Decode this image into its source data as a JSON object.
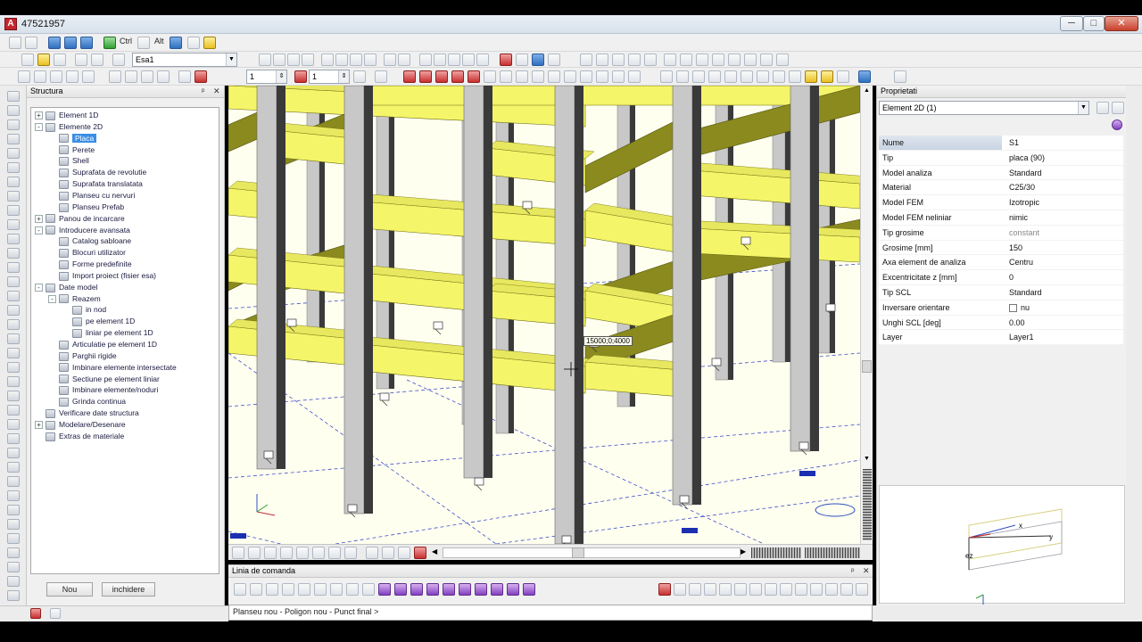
{
  "window": {
    "title": "47521957",
    "minimize": "─",
    "maximize": "□",
    "close": "✕"
  },
  "toolbar1": {
    "ctrl_label": "Ctrl",
    "alt_label": "Alt"
  },
  "toolbar2": {
    "project_combo": "Esa1"
  },
  "toolbar3": {
    "spinner1_value": "1",
    "spinner2_value": "1"
  },
  "structura": {
    "title": "Structura",
    "pin": "ᵖ",
    "close": "✕",
    "tree": [
      {
        "label": "Element 1D",
        "level": 0,
        "expander": "+"
      },
      {
        "label": "Elemente 2D",
        "level": 0,
        "expander": "-"
      },
      {
        "label": "Placa",
        "level": 1,
        "selected": true
      },
      {
        "label": "Perete",
        "level": 1
      },
      {
        "label": "Shell",
        "level": 1
      },
      {
        "label": "Suprafata de revolutie",
        "level": 1
      },
      {
        "label": "Suprafata translatata",
        "level": 1
      },
      {
        "label": "Planseu cu nervuri",
        "level": 1
      },
      {
        "label": "Planseu Prefab",
        "level": 1
      },
      {
        "label": "Panou de incarcare",
        "level": 0,
        "expander": "+"
      },
      {
        "label": "Introducere avansata",
        "level": 0,
        "expander": "-"
      },
      {
        "label": "Catalog sabloane",
        "level": 1
      },
      {
        "label": "Blocuri utilizator",
        "level": 1
      },
      {
        "label": "Forme predefinite",
        "level": 1
      },
      {
        "label": "Import proiect (fisier esa)",
        "level": 1
      },
      {
        "label": "Date model",
        "level": 0,
        "expander": "-"
      },
      {
        "label": "Reazem",
        "level": 1,
        "expander": "-"
      },
      {
        "label": "in nod",
        "level": 2
      },
      {
        "label": "pe element 1D",
        "level": 2
      },
      {
        "label": "liniar pe element 1D",
        "level": 2
      },
      {
        "label": "Articulatie pe element 1D",
        "level": 1
      },
      {
        "label": "Parghii rigide",
        "level": 1
      },
      {
        "label": "Imbinare elemente intersectate",
        "level": 1
      },
      {
        "label": "Sectiune pe element liniar",
        "level": 1
      },
      {
        "label": "Imbinare elemente/noduri",
        "level": 1
      },
      {
        "label": "Grinda continua",
        "level": 1
      },
      {
        "label": "Verificare date structura",
        "level": 0
      },
      {
        "label": "Modelare/Desenare",
        "level": 0,
        "expander": "+"
      },
      {
        "label": "Extras de materiale",
        "level": 0
      }
    ],
    "btn_new": "Nou",
    "btn_close": "inchidere"
  },
  "viewport": {
    "coord_tooltip": "15000;0;4000"
  },
  "command_panel": {
    "title": "Linia de comanda",
    "pin": "ᵖ",
    "close": "✕",
    "command_text": "Planseu nou - Poligon nou - Punct final >"
  },
  "proprietati": {
    "title": "Proprietati",
    "pin": "ᵖ",
    "close": "✕",
    "selector": "Element 2D (1)",
    "rows": [
      {
        "key": "Nume",
        "value": "S1"
      },
      {
        "key": "Tip",
        "value": "placa (90)"
      },
      {
        "key": "Model analiza",
        "value": "Standard"
      },
      {
        "key": "Material",
        "value": "C25/30"
      },
      {
        "key": "Model FEM",
        "value": "Izotropic"
      },
      {
        "key": "Model FEM neliniar",
        "value": "nimic"
      },
      {
        "key": "Tip grosime",
        "value": "constant",
        "muted": true
      },
      {
        "key": "Grosime [mm]",
        "value": "150"
      },
      {
        "key": "Axa element de analiza",
        "value": "Centru"
      },
      {
        "key": "Excentricitate z [mm]",
        "value": "0"
      },
      {
        "key": "Tip SCL",
        "value": "Standard"
      },
      {
        "key": "Inversare orientare",
        "value": "nu",
        "checkbox": true
      },
      {
        "key": "Unghi SCL [deg]",
        "value": "0.00"
      },
      {
        "key": "Layer",
        "value": "Layer1"
      }
    ]
  },
  "preview": {
    "label_ez": "ez",
    "label_x": "x",
    "label_y": "y"
  },
  "colors": {
    "beam_yellow": "#f5f56a",
    "beam_side": "#8a8a1e",
    "column_face": "#c8c8c8",
    "column_dark": "#3a3a3a",
    "selection_blue": "#3a8ee6"
  }
}
